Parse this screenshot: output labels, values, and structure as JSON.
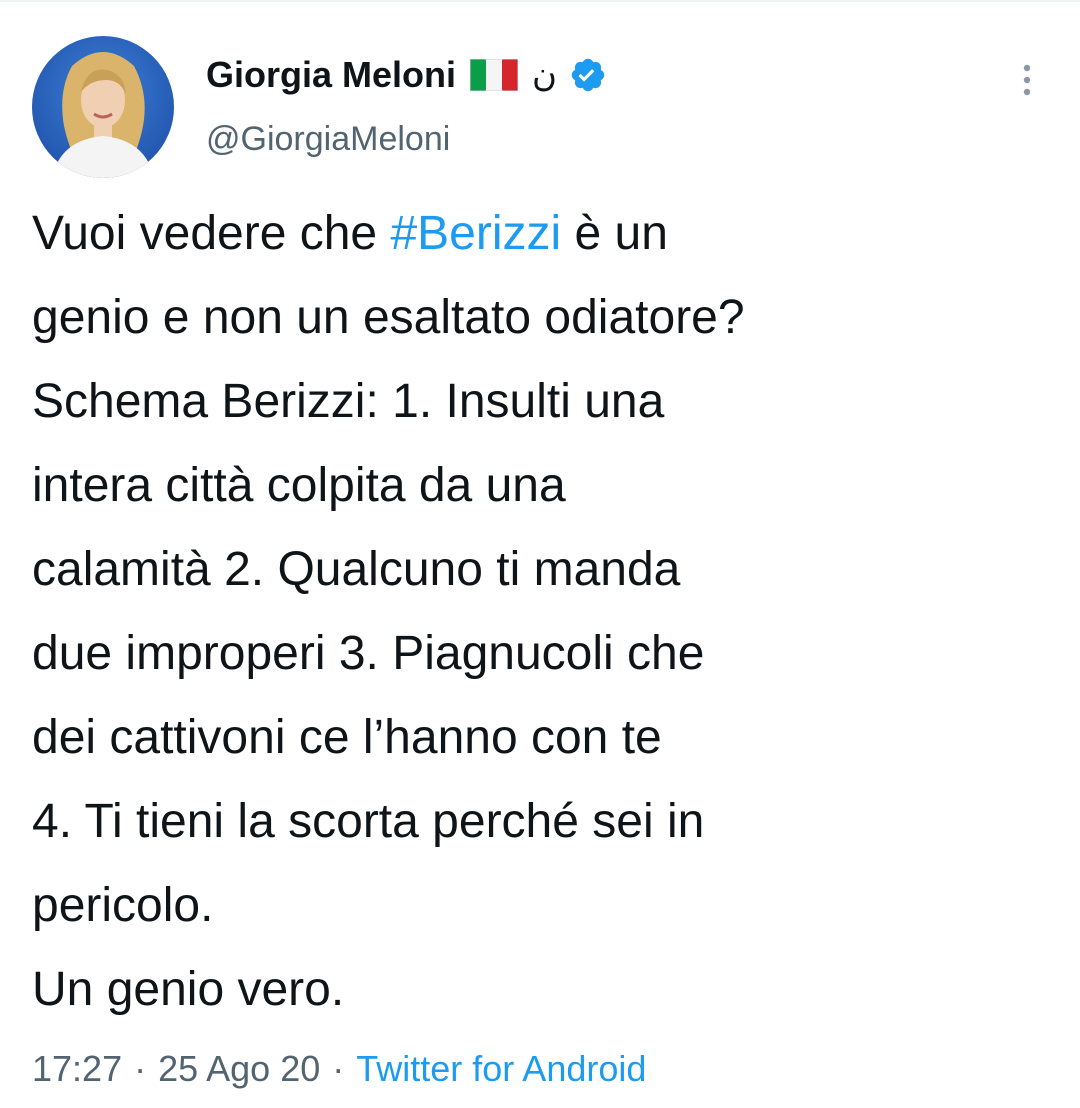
{
  "author": {
    "display_name": "Giorgia Meloni",
    "flag_icon": "italian-flag-icon",
    "extra_glyph": "ن",
    "verified_icon": "verified-badge-icon",
    "handle": "@GiorgiaMeloni"
  },
  "tweet": {
    "lines": {
      "l1_before": "Vuoi vedere che ",
      "l1_hashtag": "#Berizzi",
      "l1_after": " è un",
      "l2": "genio e non un esaltato odiatore?",
      "l3": "Schema Berizzi: 1. Insulti una",
      "l4": "intera città colpita da una",
      "l5": "calamità 2. Qualcuno ti manda",
      "l6": "due improperi 3. Piagnucoli che",
      "l7": "dei cattivoni ce l’hanno con te",
      "l8": "4. Ti tieni la scorta perché sei in",
      "l9": "pericolo.",
      "l10": "Un genio vero."
    }
  },
  "meta": {
    "time": "17:27",
    "separator": "·",
    "date": "25 Ago 20",
    "source": "Twitter for Android"
  },
  "colors": {
    "link": "#1d9bf0",
    "secondary_text": "#536471",
    "primary_text": "#0f1419"
  }
}
